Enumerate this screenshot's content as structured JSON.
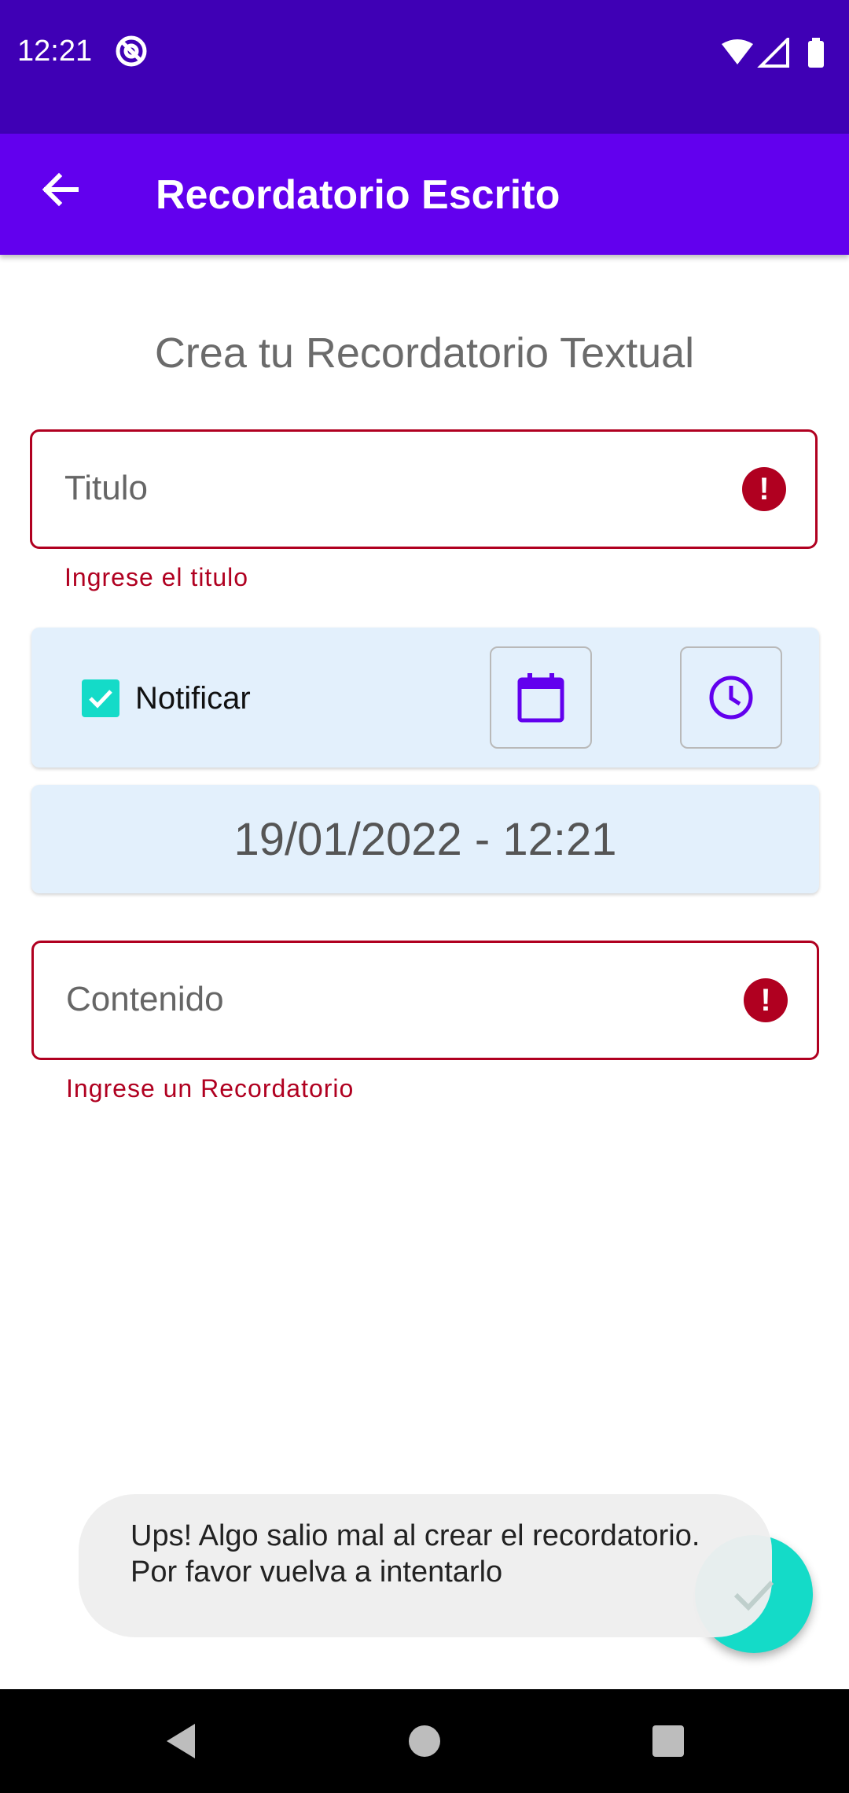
{
  "status_bar": {
    "time": "12:21"
  },
  "app_bar": {
    "title": "Recordatorio Escrito"
  },
  "heading": "Crea tu Recordatorio Textual",
  "title_field": {
    "placeholder": "Titulo",
    "error": "Ingrese el titulo",
    "error_icon": "!"
  },
  "notify": {
    "label": "Notificar",
    "checked": true
  },
  "datetime": "19/01/2022 - 12:21",
  "content_field": {
    "placeholder": "Contenido",
    "error": "Ingrese un Recordatorio",
    "error_icon": "!"
  },
  "toast": {
    "line1": "Ups! Algo salio mal al crear el recordatorio.",
    "line2": "Por favor vuelva a intentarlo"
  },
  "colors": {
    "status_bar": "#3f00b5",
    "app_bar": "#6200ee",
    "accent": "#14dbc8",
    "error": "#b00020",
    "card": "#e3f0fc"
  },
  "icons": [
    "back-arrow-icon",
    "calendar-icon",
    "clock-icon",
    "check-icon",
    "error-icon",
    "wifi-icon",
    "signal-icon",
    "battery-icon"
  ]
}
